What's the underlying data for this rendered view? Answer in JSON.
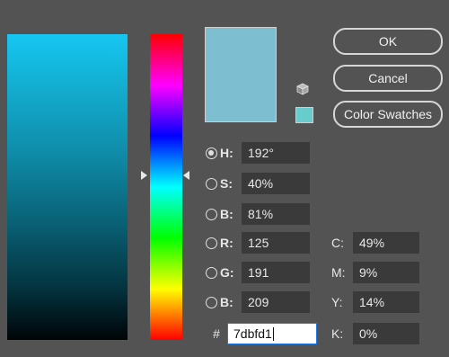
{
  "colors": {
    "current": "#7dbfd1",
    "websafe": "#66cccc"
  },
  "buttons": {
    "ok": "OK",
    "cancel": "Cancel",
    "swatches": "Color Swatches"
  },
  "icons": {
    "cube": "cube-icon"
  },
  "hsb": [
    {
      "label": "H:",
      "value": "192°",
      "selected": true
    },
    {
      "label": "S:",
      "value": "40%",
      "selected": false
    },
    {
      "label": "B:",
      "value": "81%",
      "selected": false
    }
  ],
  "rgb": [
    {
      "label": "R:",
      "value": "125",
      "selected": false
    },
    {
      "label": "G:",
      "value": "191",
      "selected": false
    },
    {
      "label": "B:",
      "value": "209",
      "selected": false
    }
  ],
  "hex": {
    "label": "#",
    "value": "7dbfd1"
  },
  "cmyk": [
    {
      "label": "C:",
      "value": "49%"
    },
    {
      "label": "M:",
      "value": "9%"
    },
    {
      "label": "Y:",
      "value": "14%"
    },
    {
      "label": "K:",
      "value": "0%"
    }
  ]
}
